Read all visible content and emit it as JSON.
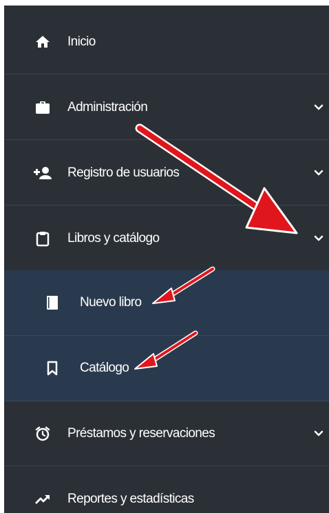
{
  "menu": {
    "inicio": "Inicio",
    "administracion": "Administración",
    "registro": "Registro de usuarios",
    "libros": "Libros y catálogo",
    "nuevo_libro": "Nuevo libro",
    "catalogo": "Catálogo",
    "prestamos": "Préstamos y reservaciones",
    "reportes": "Reportes y estadísticas"
  },
  "icons": {
    "inicio": "home-icon",
    "administracion": "briefcase-icon",
    "registro": "user-plus-icon",
    "libros": "clipboard-icon",
    "nuevo_libro": "book-icon",
    "catalogo": "bookmark-icon",
    "prestamos": "alarm-clock-icon",
    "reportes": "trending-up-icon",
    "expand": "chevron-down-icon"
  },
  "colors": {
    "sidebar_bg": "#2b3036",
    "submenu_bg": "#2a3a4e",
    "text": "#ffffff",
    "annotation_arrow": "#e0161c"
  }
}
